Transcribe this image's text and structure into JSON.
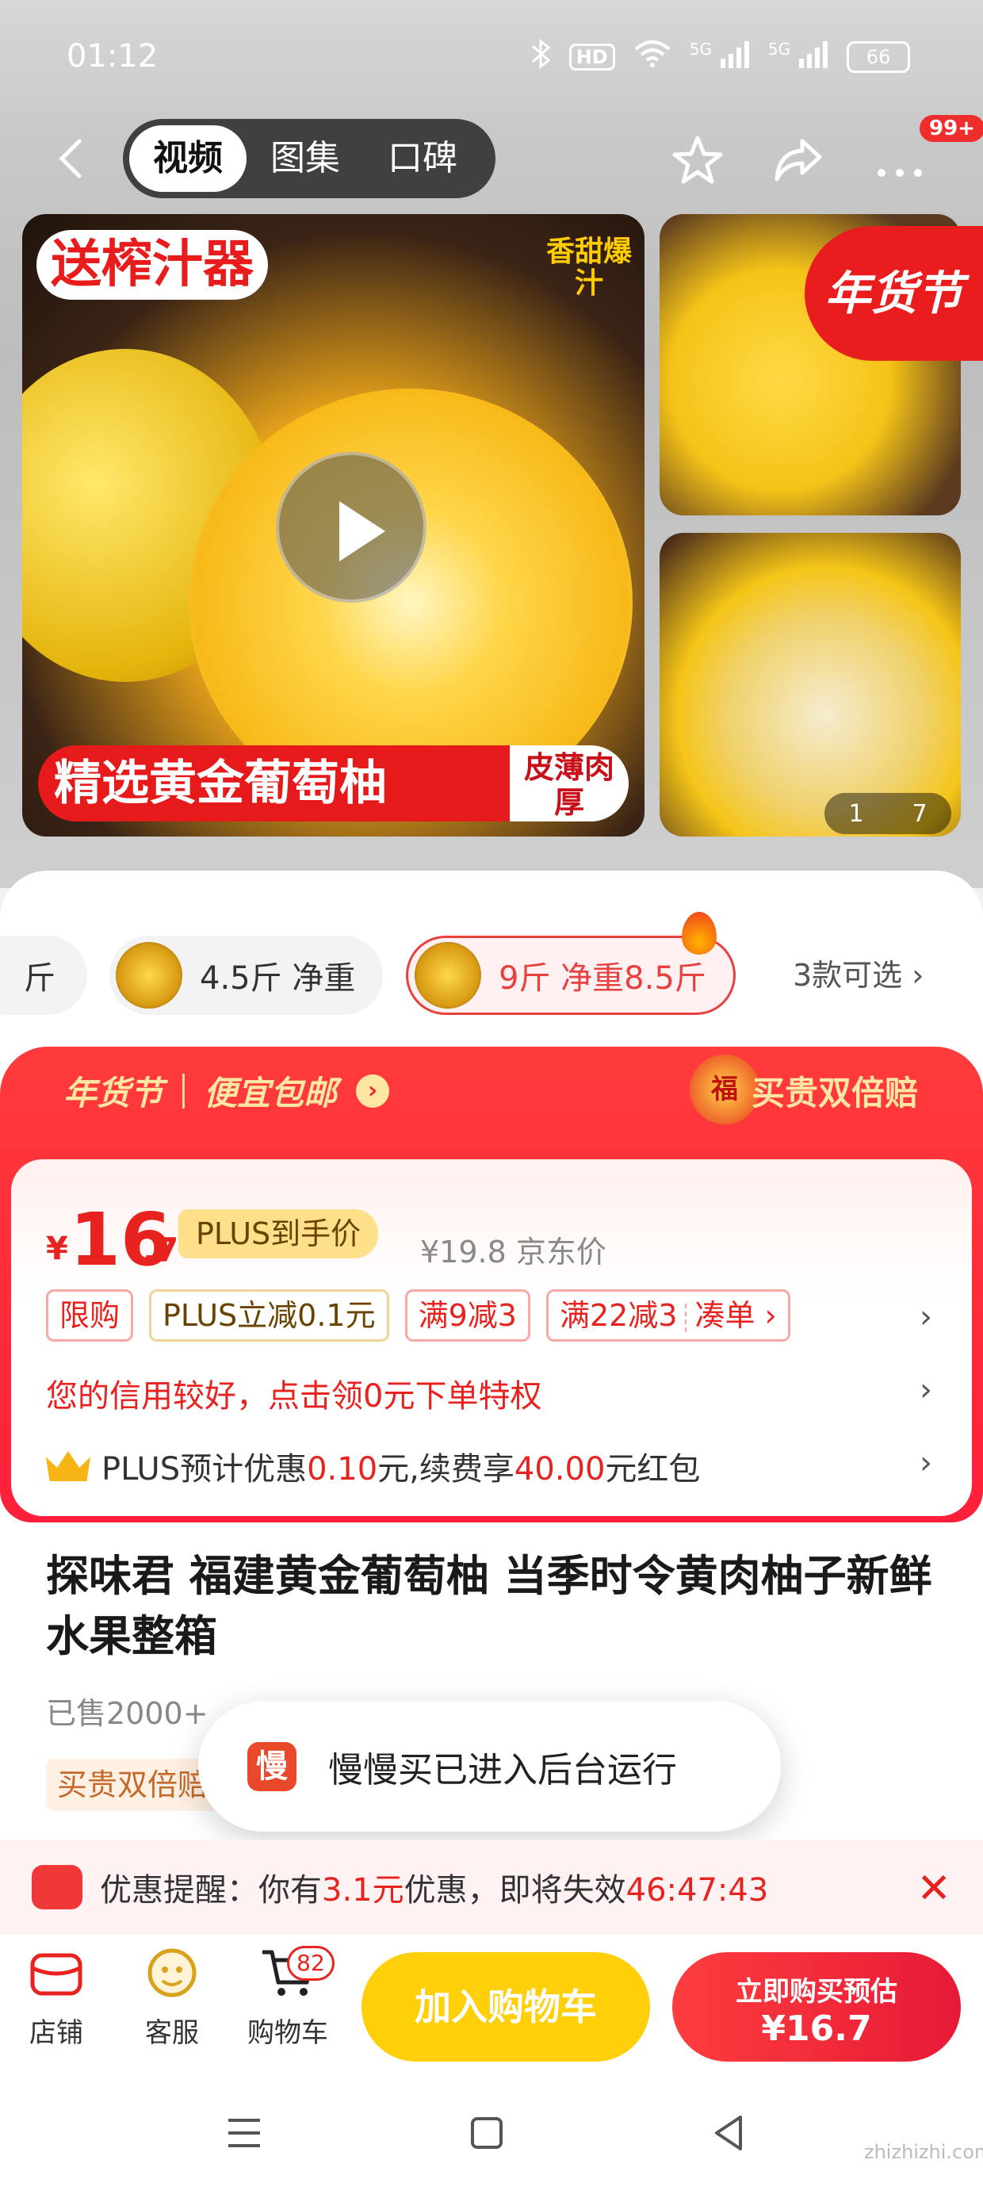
{
  "status": {
    "time": "01:12",
    "hd": "HD",
    "net1": "5G",
    "net2": "5G",
    "battery": "66"
  },
  "nav": {
    "tabs": [
      "视频",
      "图集",
      "口碑"
    ],
    "badge": "99+"
  },
  "gallery": {
    "promo_tag": "送榨汁器",
    "promo_side": "香甜爆汁",
    "banner_main": "精选黄金葡萄柚",
    "banner_side": "皮薄肉厚",
    "festival": "年货节",
    "pager_current": "1",
    "pager_total": "7"
  },
  "variants": {
    "partial": "斤",
    "items": [
      "4.5斤 净重",
      "9斤 净重8.5斤"
    ],
    "more": "3款可选 ›"
  },
  "promo": {
    "festival": "年货节",
    "shipping": "便宜包邮",
    "double": "买贵双倍赔",
    "fu": "福",
    "yen": "¥",
    "price_int": "16",
    "price_dec": ".7",
    "plus_price_label": "PLUS到手价",
    "jd_price": "¥19.8 京东价",
    "tags": [
      "限购",
      "PLUS立减0.1元",
      "满9减3",
      "满22减3",
      "凑单 ›"
    ],
    "credit": "您的信用较好，点击领0元下单特权",
    "plus_prefix": "PLUS预计优惠",
    "plus_amount": "0.10",
    "plus_mid": "元,续费享",
    "plus_amount2": "40.00",
    "plus_suffix": "元红包"
  },
  "product": {
    "title": "探味君 福建黄金葡萄柚 当季时令黄肉柚子新鲜水果整箱",
    "sold": "已售2000+",
    "buy_tag": "买贵双倍赔"
  },
  "toast": {
    "icon": "慢",
    "text": "慢慢买已进入后台运行"
  },
  "reminder": {
    "prefix": "优惠提醒：你有",
    "amount": "3.1元",
    "mid": "优惠，即将失效",
    "countdown": "46:47:43"
  },
  "bottombar": {
    "shop": "店铺",
    "service": "客服",
    "cart": "购物车",
    "cart_count": "82",
    "add_cart": "加入购物车",
    "buy_line1": "立即购买预估",
    "buy_line2": "¥16.7"
  },
  "watermark": "zhizhizhi.com",
  "colors": {
    "accent": "#e8231f",
    "add_cart": "#ffcf0a",
    "plus_gold": "#ffe08a"
  }
}
